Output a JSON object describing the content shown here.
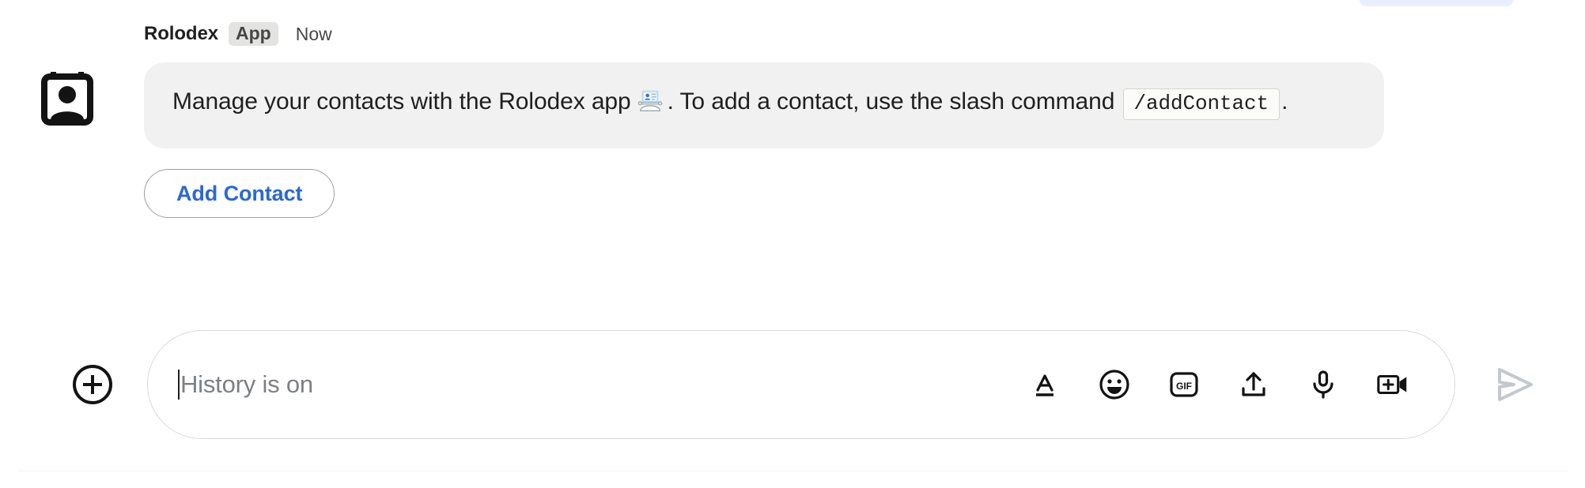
{
  "message": {
    "avatar_icon": "rolodex-contact-card-icon",
    "sender": "Rolodex",
    "badge": "App",
    "timestamp": "Now",
    "text_part_1": "Manage your contacts with the Rolodex app",
    "emoji": "card-index-emoji",
    "text_part_2": ". To add a contact, use the slash command",
    "code": "/addContact",
    "text_part_3": ".",
    "action_button_label": "Add Contact",
    "action_button_color": "#2a67d8"
  },
  "composer": {
    "add_label": "plus-icon",
    "placeholder": "History is on",
    "value": "",
    "tools": [
      {
        "name": "format-text-icon",
        "label": "A"
      },
      {
        "name": "emoji-icon",
        "label": ""
      },
      {
        "name": "gif-icon",
        "label": "GIF"
      },
      {
        "name": "upload-icon",
        "label": ""
      },
      {
        "name": "microphone-icon",
        "label": ""
      },
      {
        "name": "add-video-icon",
        "label": ""
      }
    ],
    "send_label": "send-icon",
    "send_color": "#c3c8d0"
  },
  "colors": {
    "bubble_bg": "#f1f1f1",
    "badge_bg": "#e3e3e1",
    "accent": "#2a67d8",
    "text": "#1f1f1f",
    "muted": "#444746"
  }
}
